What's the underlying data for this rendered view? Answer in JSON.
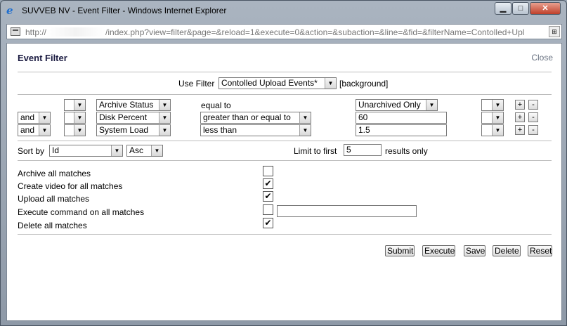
{
  "window": {
    "title": "SUVVEB NV - Event Filter - Windows Internet Explorer",
    "minimize_glyph": "▁",
    "maximize_glyph": "□",
    "close_glyph": "✕",
    "icon": "ie-icon"
  },
  "address": {
    "prefix": "http://",
    "rest": "/index.php?view=filter&page=&reload=1&execute=0&action=&subaction=&line=&fid=&filterName=Contolled+Upl"
  },
  "dialog": {
    "heading": "Event Filter",
    "close_label": "Close"
  },
  "use_filter": {
    "label": "Use Filter",
    "selected": "Contolled Upload Events*",
    "note": "[background]"
  },
  "filter_rows": [
    {
      "conj": "",
      "open_paren": "",
      "attribute": "Archive Status",
      "operator": "equal to",
      "value": "Unarchived Only",
      "close_paren": ""
    },
    {
      "conj": "and",
      "open_paren": "",
      "attribute": "Disk Percent",
      "operator": "greater than or equal to",
      "value": "60",
      "close_paren": ""
    },
    {
      "conj": "and",
      "open_paren": "",
      "attribute": "System Load",
      "operator": "less than",
      "value": "1.5",
      "close_paren": ""
    }
  ],
  "plus_label": "+",
  "minus_label": "-",
  "sort": {
    "label": "Sort by",
    "field": "Id",
    "direction": "Asc"
  },
  "limit": {
    "prefix": "Limit to first",
    "value": "5",
    "suffix": "results only"
  },
  "actions": [
    {
      "label": "Archive all matches",
      "checked": false
    },
    {
      "label": "Create video for all matches",
      "checked": true
    },
    {
      "label": "Upload all matches",
      "checked": true
    },
    {
      "label": "Execute command on all matches",
      "checked": false,
      "command": ""
    },
    {
      "label": "Delete all matches",
      "checked": true
    }
  ],
  "buttons": {
    "submit": "Submit",
    "execute": "Execute",
    "save": "Save",
    "delete": "Delete",
    "reset": "Reset"
  },
  "check_glyph": "✔"
}
